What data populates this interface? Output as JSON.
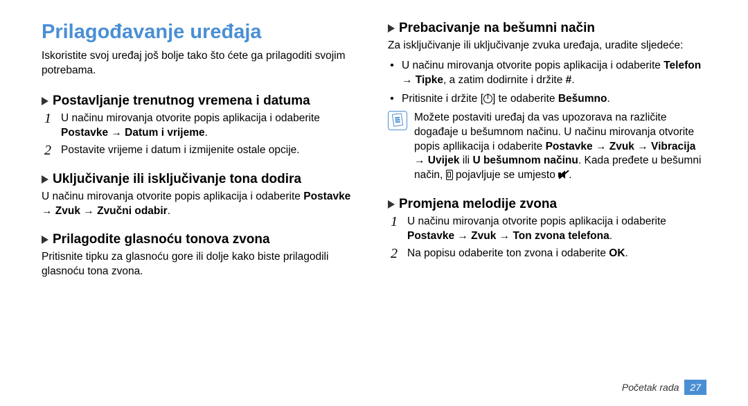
{
  "title": "Prilagođavanje uređaja",
  "intro": "Iskoristite svoj uređaj još bolje tako što ćete ga prilagoditi svojim potrebama.",
  "left": {
    "s1": {
      "heading": "Postavljanje trenutnog vremena i datuma",
      "step1_a": "U načinu mirovanja otvorite popis aplikacija i odaberite ",
      "step1_b": "Postavke → Datum i vrijeme",
      "step1_c": ".",
      "step2": "Postavite vrijeme i datum i izmijenite ostale opcije."
    },
    "s2": {
      "heading": "Uključivanje ili isključivanje tona dodira",
      "line_a": "U načinu mirovanja otvorite popis aplikacija i odaberite ",
      "line_b": "Postavke → Zvuk → Zvučni odabir",
      "line_c": "."
    },
    "s3": {
      "heading": "Prilagodite glasnoću tonova zvona",
      "line": "Pritisnite tipku za glasnoću gore ili dolje kako biste prilagodili glasnoću tona zvona."
    }
  },
  "right": {
    "s1": {
      "heading": "Prebacivanje na bešumni način",
      "intro": "Za isključivanje ili uključivanje zvuka uređaja, uradite sljedeće:",
      "b1_a": "U načinu mirovanja otvorite popis aplikacija i odaberite ",
      "b1_b": "Telefon → Tipke",
      "b1_c": ", a zatim dodirnite i držite ",
      "b1_d": "#",
      "b1_e": ".",
      "b2_a": "Pritisnite i držite [",
      "b2_b": "] te odaberite ",
      "b2_c": "Bešumno",
      "b2_d": ".",
      "note_a": "Možete postaviti uređaj da vas upozorava na različite događaje u bešumnom načinu. U načinu mirovanja otvorite popis apllikacija i odaberite ",
      "note_b": "Postavke → Zvuk → Vibracija → Uvijek",
      "note_c": " ili ",
      "note_d": "U bešumnom načinu",
      "note_e": ". Kada pređete u bešumni način, ",
      "note_f": " pojavljuje se umjesto ",
      "note_g": "."
    },
    "s2": {
      "heading": "Promjena melodije zvona",
      "step1_a": "U načinu mirovanja otvorite popis aplikacija i odaberite ",
      "step1_b": "Postavke → Zvuk → Ton zvona telefona",
      "step1_c": ".",
      "step2_a": "Na popisu odaberite ton zvona i odaberite ",
      "step2_b": "OK",
      "step2_c": "."
    }
  },
  "footer": {
    "label": "Početak rada",
    "page": "27"
  }
}
